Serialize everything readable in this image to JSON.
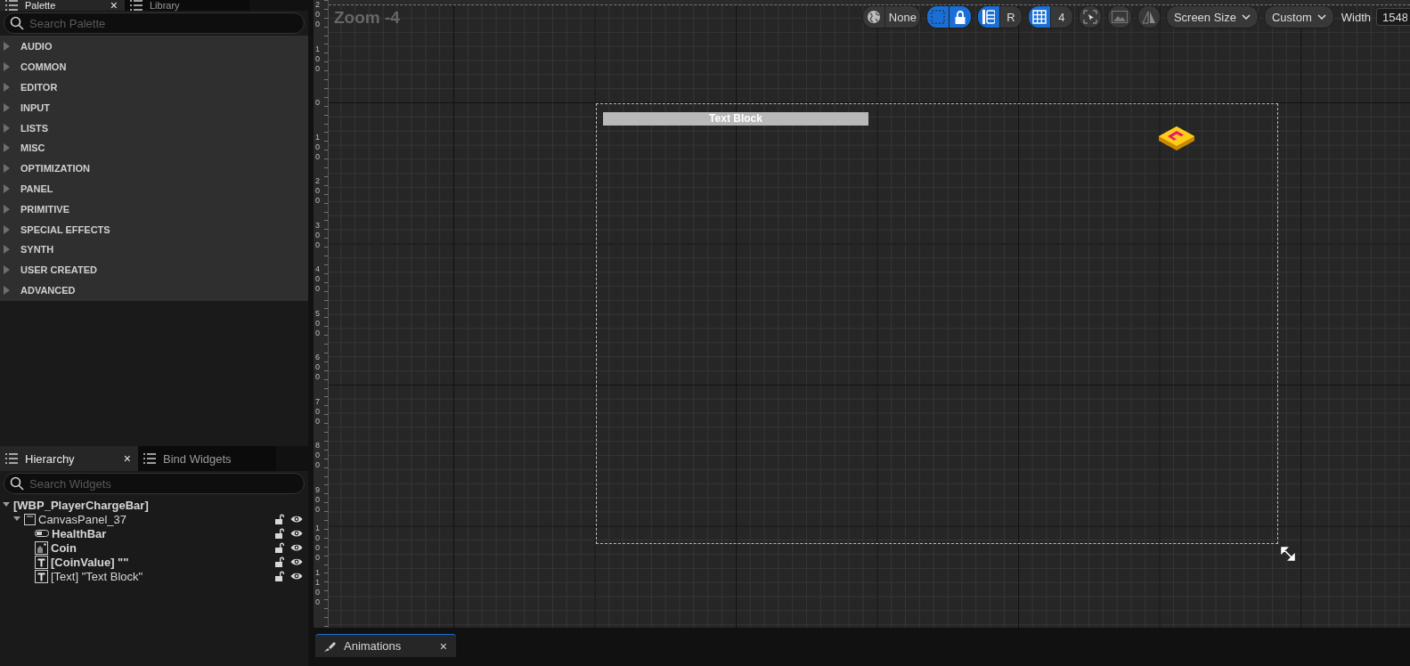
{
  "palette_tabs": [
    {
      "label": "Palette",
      "selected": true,
      "close": "×"
    },
    {
      "label": "Library",
      "selected": false
    }
  ],
  "palette_search": {
    "placeholder": "Search Palette"
  },
  "palette_categories": [
    "AUDIO",
    "COMMON",
    "EDITOR",
    "INPUT",
    "LISTS",
    "MISC",
    "OPTIMIZATION",
    "PANEL",
    "PRIMITIVE",
    "SPECIAL EFFECTS",
    "SYNTH",
    "USER CREATED",
    "ADVANCED"
  ],
  "hierarchy_tabs": [
    {
      "label": "Hierarchy",
      "selected": true,
      "close": "×"
    },
    {
      "label": "Bind Widgets",
      "selected": false
    }
  ],
  "hierarchy_search": {
    "placeholder": "Search Widgets"
  },
  "hierarchy": [
    {
      "label": "[WBP_PlayerChargeBar]",
      "kind": "root",
      "bold": true,
      "expanded": true,
      "children": [
        {
          "label": "CanvasPanel_37",
          "kind": "canvas",
          "bold": false,
          "expanded": true,
          "children": [
            {
              "label": "HealthBar",
              "kind": "progress",
              "bold": true
            },
            {
              "label": "Coin",
              "kind": "image",
              "bold": true
            },
            {
              "label": "[CoinValue] \"\"",
              "kind": "text",
              "bold": true
            },
            {
              "label": "[Text] \"Text Block\"",
              "kind": "text",
              "bold": false
            }
          ]
        }
      ]
    }
  ],
  "viewport": {
    "zoom_label": "Zoom -4",
    "ruler_labels": [
      "200",
      "100",
      "0",
      "100",
      "200",
      "300",
      "400",
      "500",
      "600",
      "700",
      "800",
      "900",
      "1000",
      "1100"
    ],
    "toolbar_groups": [
      [
        {
          "kind": "icon",
          "on": false
        },
        {
          "kind": "text",
          "text": "None",
          "on": false
        }
      ],
      [
        {
          "kind": "icon",
          "on": true
        },
        {
          "kind": "icon",
          "on": true
        }
      ],
      [
        {
          "kind": "icon",
          "on": true
        },
        {
          "kind": "text",
          "text": "R",
          "on": false
        }
      ],
      [
        {
          "kind": "icon",
          "on": true
        },
        {
          "kind": "text",
          "text": "4",
          "on": false
        }
      ],
      [
        {
          "kind": "icon",
          "on": false
        }
      ],
      [
        {
          "kind": "icon",
          "on": false
        }
      ],
      [
        {
          "kind": "icon",
          "on": false
        }
      ]
    ],
    "dropdowns": [
      {
        "label": "Screen Size"
      },
      {
        "label": "Custom"
      }
    ],
    "width_field": {
      "label": "Width",
      "value": "1548"
    },
    "widgets": [
      {
        "kind": "text_block",
        "text": "Text Block"
      },
      {
        "kind": "coin_image"
      }
    ]
  },
  "bottom_tabs": [
    {
      "label": "Animations",
      "selected": true,
      "close": "×"
    }
  ]
}
